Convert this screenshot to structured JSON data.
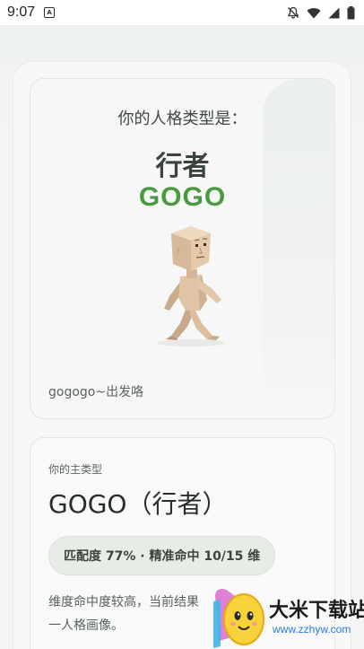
{
  "status_bar": {
    "time": "9:07",
    "notification_icon": "A"
  },
  "result": {
    "prompt": "你的人格类型是：",
    "type_name": "行者",
    "type_code": "GOGO",
    "tagline": "gogogo~出发咯"
  },
  "main_type": {
    "label": "你的主类型",
    "title": "GOGO（行者）",
    "match": "匹配度 77% · 精准命中 10/15 维",
    "description": "维度命中度较高，当前结果\n一人格画像。"
  },
  "watermark": {
    "title": "大米下载站",
    "url": "www.zzhyw.com"
  },
  "colors": {
    "accent": "#4a9a42",
    "background": "#f3f5f3"
  }
}
